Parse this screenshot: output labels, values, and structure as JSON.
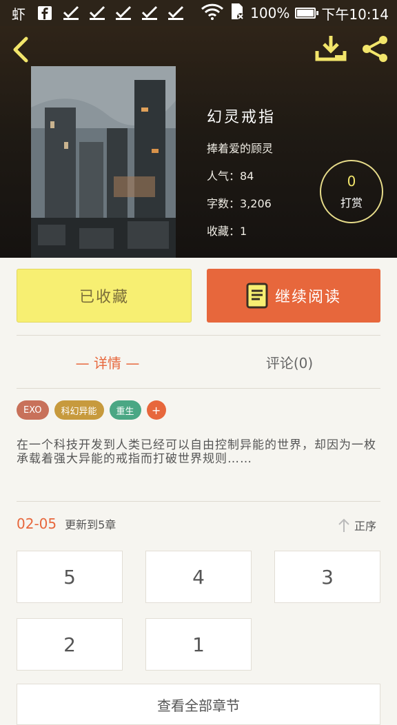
{
  "status_bar": {
    "left_icons": [
      "app-icon",
      "facebook-icon",
      "check-icon",
      "check-icon",
      "check-icon",
      "check-icon",
      "check-icon"
    ],
    "app_char": "虾",
    "battery": "100%",
    "time": "下午10:14"
  },
  "book": {
    "title": "幻灵戒指",
    "author": "捧着爱的顾灵",
    "popularity": "人气：84",
    "word_count": "字数：3,206",
    "favorites": "收藏：1"
  },
  "tip": {
    "count": "0",
    "label": "打赏"
  },
  "actions": {
    "favorited_label": "已收藏",
    "continue_label": "继续阅读"
  },
  "tabs": {
    "detail": "— 详情 —",
    "comments": "评论(0)"
  },
  "tags": [
    {
      "label": "EXO",
      "color": "#c8715a"
    },
    {
      "label": "科幻异能",
      "color": "#c79a3d"
    },
    {
      "label": "重生",
      "color": "#4aa784"
    },
    {
      "label": "+",
      "color": "#e7673c"
    }
  ],
  "summary": "在一个科技开发到人类已经可以自由控制异能的世界，却因为一枚承载着强大异能的戒指而打破世界规则……",
  "update": {
    "date": "02-05",
    "text": "更新到5章",
    "sort_label": "正序"
  },
  "chapters": [
    "5",
    "4",
    "3",
    "2",
    "1"
  ],
  "all_chapters_label": "查看全部章节",
  "colors": {
    "accent": "#e7673c",
    "fav_bg": "#f7ef72",
    "tip_ring": "#e7dc8a"
  }
}
